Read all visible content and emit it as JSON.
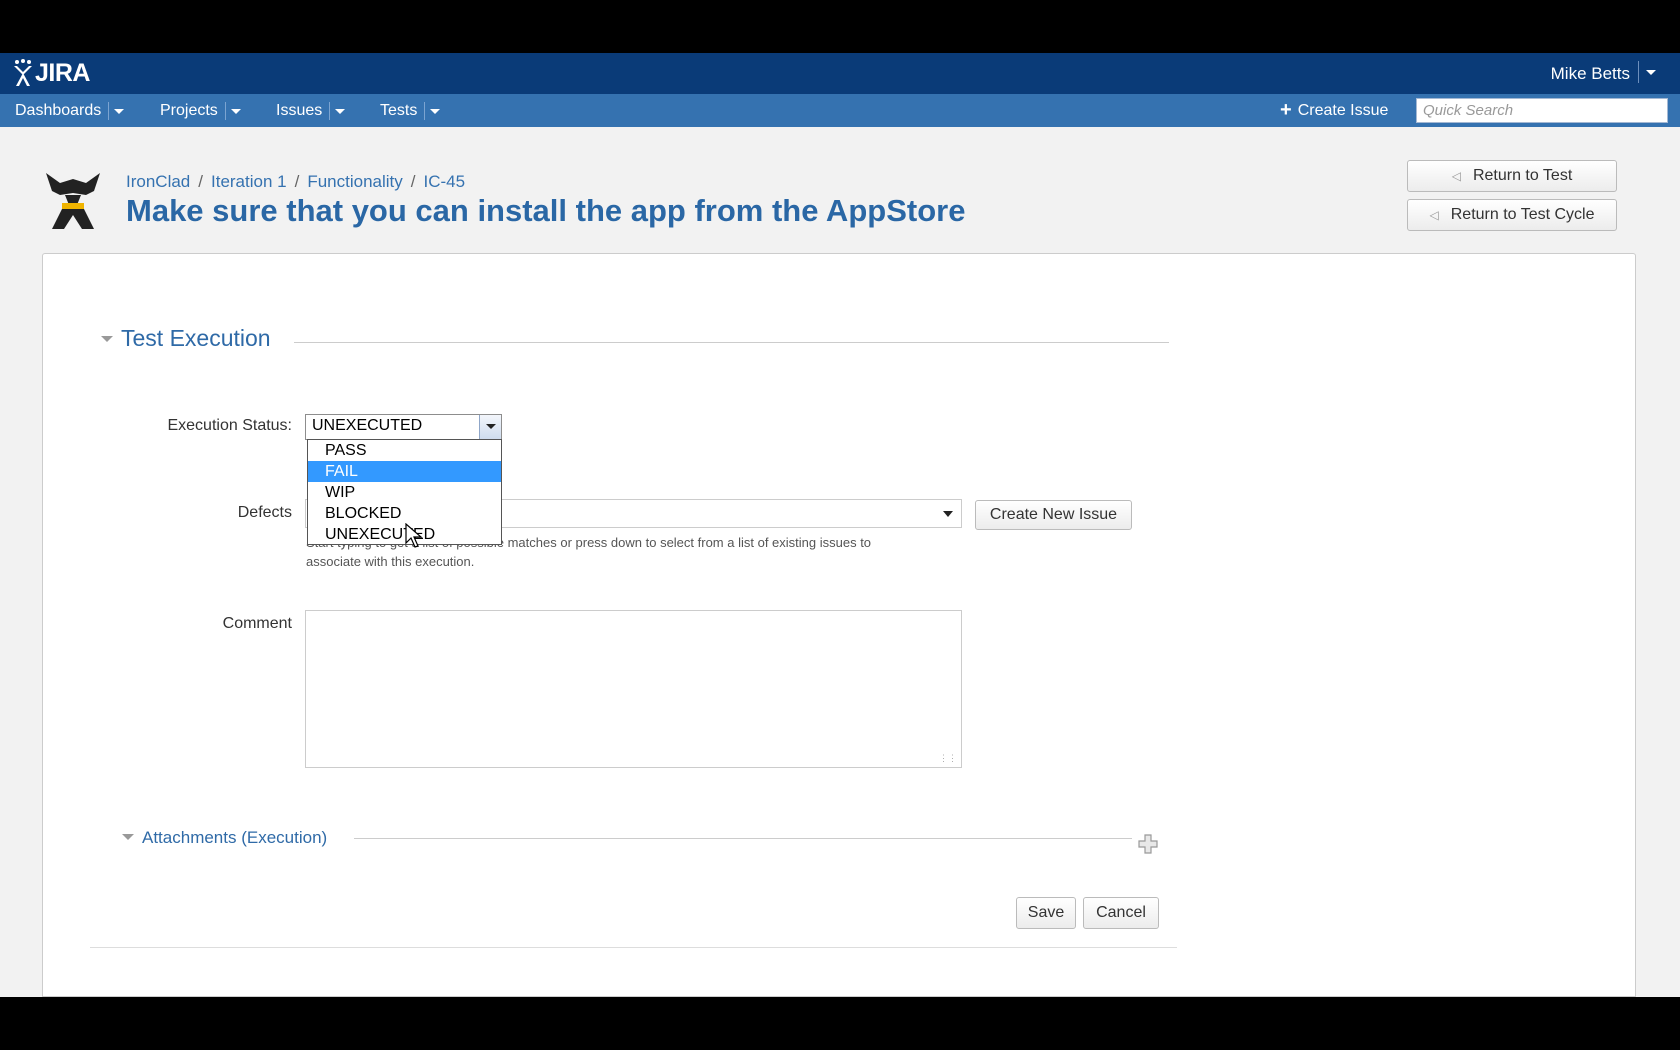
{
  "header": {
    "logo_text": "JIRA",
    "user_name": "Mike Betts"
  },
  "nav": {
    "items": [
      {
        "label": "Dashboards"
      },
      {
        "label": "Projects"
      },
      {
        "label": "Issues"
      },
      {
        "label": "Tests"
      }
    ],
    "create_issue": "Create Issue",
    "search_placeholder": "Quick Search"
  },
  "page": {
    "breadcrumbs": [
      "IronClad",
      "Iteration 1",
      "Functionality",
      "IC-45"
    ],
    "title": "Make sure that you can install the app from the AppStore",
    "return_to_test": "Return to Test",
    "return_to_test_cycle": "Return to Test Cycle"
  },
  "execution": {
    "section_title": "Test Execution",
    "status_label": "Execution Status:",
    "status_value": "UNEXECUTED",
    "status_options": [
      "PASS",
      "FAIL",
      "WIP",
      "BLOCKED",
      "UNEXECUTED"
    ],
    "highlighted_option": "FAIL",
    "defects_label": "Defects",
    "create_new_issue": "Create New Issue",
    "help_text_line1": "Start typing to get a list of possible matches or press down to select from a list of existing issues to",
    "help_text_line2": "associate with this execution.",
    "comment_label": "Comment",
    "comment_value": "",
    "attachments_title": "Attachments (Execution)",
    "save": "Save",
    "cancel": "Cancel"
  },
  "colors": {
    "topbar": "#0a3b78",
    "navbar": "#3572b0",
    "link": "#3572b0",
    "highlight": "#3399ff"
  }
}
